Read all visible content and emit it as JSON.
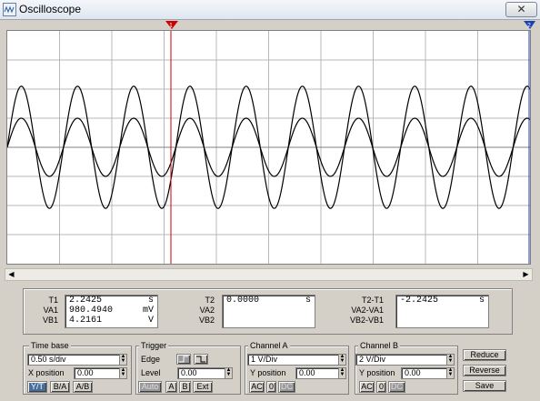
{
  "window": {
    "title": "Oscilloscope",
    "close_glyph": "✕"
  },
  "display": {
    "background": "#ffffff",
    "grid_color": "#b8b8b8",
    "trace_color": "#000000",
    "cursor1_color": "#cc0000",
    "cursor2_color": "#1a3fb0",
    "cursor1_label": "1",
    "cursor2_label": "2"
  },
  "chart_data": {
    "type": "line",
    "xlabel": "",
    "ylabel": "",
    "x_divisions": 10,
    "y_divisions": 8,
    "series": [
      {
        "amplitude_div": 2.1,
        "cycles_on_screen": 9.3,
        "phase_deg": 0
      },
      {
        "amplitude_div": 1.0,
        "cycles_on_screen": 9.3,
        "phase_deg": 0
      }
    ]
  },
  "readouts": {
    "t1": {
      "label": "T1",
      "value": "2.2425",
      "unit": "s"
    },
    "va1": {
      "label": "VA1",
      "value": "980.4940",
      "unit": "mV"
    },
    "vb1": {
      "label": "VB1",
      "value": "4.2161",
      "unit": "V"
    },
    "t2": {
      "label": "T2",
      "value": "0.0000",
      "unit": "s"
    },
    "va2": {
      "label": "VA2"
    },
    "vb2": {
      "label": "VB2"
    },
    "dt": {
      "label": "T2-T1",
      "value": "-2.2425",
      "unit": "s"
    },
    "dva": {
      "label": "VA2-VA1"
    },
    "dvb": {
      "label": "VB2-VB1"
    }
  },
  "timebase": {
    "title": "Time base",
    "scale": "0.50 s/div",
    "xpos_label": "X position",
    "xpos": "0.00",
    "buttons": [
      "Y/T",
      "B/A",
      "A/B"
    ]
  },
  "trigger": {
    "title": "Trigger",
    "edge_label": "Edge",
    "level_label": "Level",
    "level": "0.00",
    "buttons": [
      "Auto",
      "A",
      "B",
      "Ext"
    ]
  },
  "channel_a": {
    "title": "Channel A",
    "scale": "1 V/Div",
    "ypos_label": "Y position",
    "ypos": "0.00",
    "coupling": [
      "AC",
      "0",
      "DC"
    ]
  },
  "channel_b": {
    "title": "Channel B",
    "scale": "2 V/Div",
    "ypos_label": "Y position",
    "ypos": "0.00",
    "coupling": [
      "AC",
      "0",
      "DC"
    ]
  },
  "actions": {
    "reduce": "Reduce",
    "reverse": "Reverse",
    "save": "Save"
  }
}
